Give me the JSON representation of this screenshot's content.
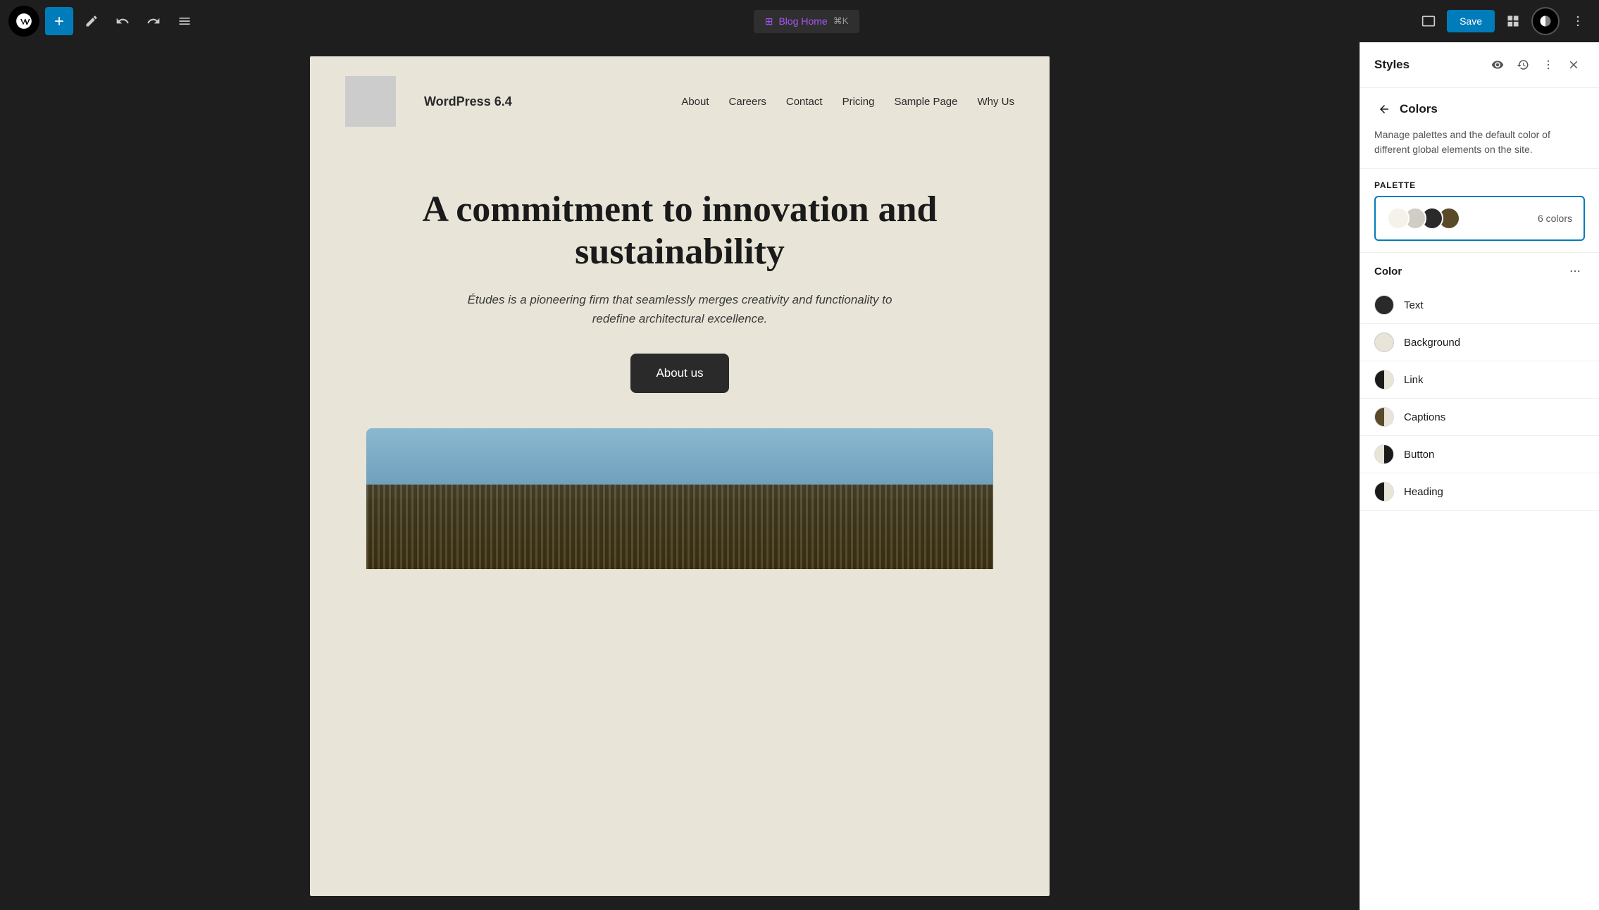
{
  "toolbar": {
    "add_label": "+",
    "undo_label": "↩",
    "redo_label": "↪",
    "list_label": "≡",
    "page_icon": "⊞",
    "page_name": "Blog Home",
    "shortcut": "⌘K",
    "save_label": "Save",
    "more_label": "⋯"
  },
  "site": {
    "name": "WordPress 6.4",
    "nav": [
      "About",
      "Careers",
      "Contact",
      "Pricing",
      "Sample Page",
      "Why Us"
    ]
  },
  "hero": {
    "title": "A commitment to innovation and sustainability",
    "subtitle": "Études is a pioneering firm that seamlessly merges creativity and functionality to redefine architectural excellence.",
    "button": "About us"
  },
  "styles_panel": {
    "title": "Styles",
    "back_label": "‹",
    "subtitle": "Colors",
    "description": "Manage palettes and the default color of different global elements on the site.",
    "palette_label": "PALETTE",
    "palette_count": "6 colors",
    "palette_swatches": [
      {
        "color": "#f5f2ea"
      },
      {
        "color": "#d0cdc4"
      },
      {
        "color": "#2a2a2a"
      },
      {
        "color": "#5a4a2a"
      }
    ],
    "color_section_label": "Color",
    "colors": [
      {
        "label": "Text",
        "type": "solid",
        "value": "#2a2a2a"
      },
      {
        "label": "Background",
        "type": "solid",
        "value": "#e8e4d8"
      },
      {
        "label": "Link",
        "type": "half",
        "left": "#1a1a1a",
        "right": "#e8e4d8"
      },
      {
        "label": "Captions",
        "type": "half-captions",
        "left": "#5a4a2a",
        "right": "#e8e4d8"
      },
      {
        "label": "Button",
        "type": "half-button",
        "left": "#e8e4d8",
        "right": "#1a1a1a"
      },
      {
        "label": "Heading",
        "type": "half-heading",
        "left": "#1a1a1a",
        "right": "#e8e4d8"
      }
    ]
  }
}
